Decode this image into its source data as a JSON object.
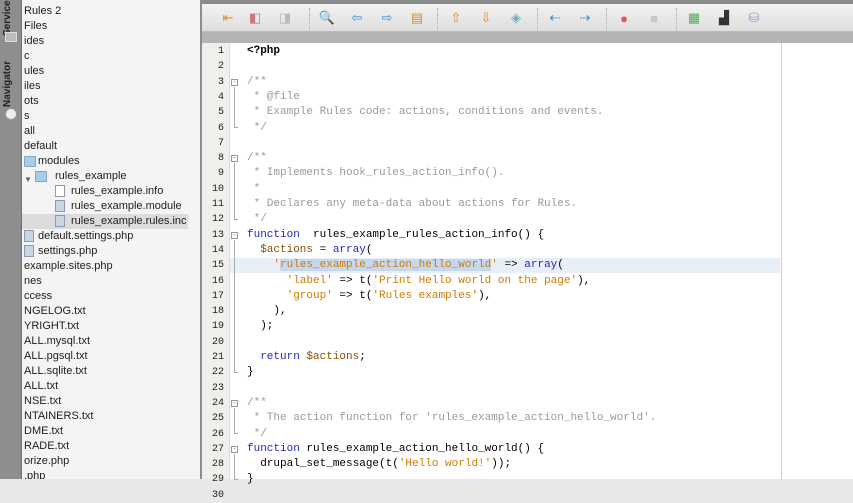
{
  "side_tabs": [
    {
      "label": "Services",
      "icon": "services-icon"
    },
    {
      "label": "Navigator",
      "icon": "compass-icon"
    }
  ],
  "tree": [
    {
      "label": "Rules 2",
      "level": 0,
      "icon": "none"
    },
    {
      "label": "Files",
      "level": 0,
      "icon": "none"
    },
    {
      "label": "ides",
      "level": 0,
      "icon": "none"
    },
    {
      "label": "c",
      "level": 0,
      "icon": "none"
    },
    {
      "label": "ules",
      "level": 0,
      "icon": "none"
    },
    {
      "label": "iles",
      "level": 0,
      "icon": "none"
    },
    {
      "label": "ots",
      "level": 0,
      "icon": "none"
    },
    {
      "label": "s",
      "level": 0,
      "icon": "none"
    },
    {
      "label": "all",
      "level": 0,
      "icon": "none"
    },
    {
      "label": "default",
      "level": 0,
      "icon": "none"
    },
    {
      "label": "modules",
      "level": 1,
      "icon": "folder"
    },
    {
      "label": "rules_example",
      "level": 2,
      "icon": "folder",
      "expanded": true
    },
    {
      "label": "rules_example.info",
      "level": 3,
      "icon": "file"
    },
    {
      "label": "rules_example.module",
      "level": 3,
      "icon": "php"
    },
    {
      "label": "rules_example.rules.inc",
      "level": 3,
      "icon": "php",
      "selected": true
    },
    {
      "label": "default.settings.php",
      "level": 1,
      "icon": "php"
    },
    {
      "label": "settings.php",
      "level": 1,
      "icon": "php"
    },
    {
      "label": "example.sites.php",
      "level": 0,
      "icon": "none"
    },
    {
      "label": "nes",
      "level": 0,
      "icon": "none"
    },
    {
      "label": "ccess",
      "level": 0,
      "icon": "none"
    },
    {
      "label": "NGELOG.txt",
      "level": 0,
      "icon": "none"
    },
    {
      "label": "YRIGHT.txt",
      "level": 0,
      "icon": "none"
    },
    {
      "label": "ALL.mysql.txt",
      "level": 0,
      "icon": "none"
    },
    {
      "label": "ALL.pgsql.txt",
      "level": 0,
      "icon": "none"
    },
    {
      "label": "ALL.sqlite.txt",
      "level": 0,
      "icon": "none"
    },
    {
      "label": "ALL.txt",
      "level": 0,
      "icon": "none"
    },
    {
      "label": "NSE.txt",
      "level": 0,
      "icon": "none"
    },
    {
      "label": "NTAINERS.txt",
      "level": 0,
      "icon": "none"
    },
    {
      "label": "DME.txt",
      "level": 0,
      "icon": "none"
    },
    {
      "label": "RADE.txt",
      "level": 0,
      "icon": "none"
    },
    {
      "label": "orize.php",
      "level": 0,
      "icon": "none"
    },
    {
      ".label": "",
      ".x": "",
      "label": ".php",
      "level": 0,
      "icon": "none"
    }
  ],
  "toolbar": [
    {
      "name": "last-edit-icon",
      "glyph": "⇤",
      "color": "#d98a2b"
    },
    {
      "name": "back-icon",
      "glyph": "◧",
      "color": "#c77"
    },
    {
      "name": "forward-icon",
      "glyph": "◨",
      "color": "#bbb"
    },
    {
      "name": "find-icon",
      "glyph": "🔍",
      "color": "#555"
    },
    {
      "name": "find-previous-icon",
      "glyph": "⇦",
      "color": "#3a8fd0"
    },
    {
      "name": "find-next-icon",
      "glyph": "⇨",
      "color": "#3a8fd0"
    },
    {
      "name": "toggle-highlight-icon",
      "glyph": "▤",
      "color": "#d98a2b"
    },
    {
      "name": "previous-bookmark-icon",
      "glyph": "⇧",
      "color": "#e08a2b"
    },
    {
      "name": "next-bookmark-icon",
      "glyph": "⇩",
      "color": "#e08a2b"
    },
    {
      "name": "toggle-bookmark-icon",
      "glyph": "◈",
      "color": "#7ab"
    },
    {
      "name": "shift-left-icon",
      "glyph": "⇠",
      "color": "#3a8fd0"
    },
    {
      "name": "shift-right-icon",
      "glyph": "⇢",
      "color": "#3a8fd0"
    },
    {
      "name": "start-macro-icon",
      "glyph": "●",
      "color": "#e8505a"
    },
    {
      "name": "stop-macro-icon",
      "glyph": "■",
      "color": "#c8c8c8"
    },
    {
      "name": "comment-icon",
      "glyph": "▦",
      "color": "#4caf50"
    },
    {
      "name": "uncomment-icon",
      "glyph": "▟",
      "color": "#333"
    },
    {
      "name": "database-icon",
      "glyph": "⛁",
      "color": "#9999cc"
    }
  ],
  "code": [
    [
      [
        "b",
        "<?php"
      ]
    ],
    [],
    [
      [
        "c",
        "/**"
      ]
    ],
    [
      [
        "c",
        " * @file"
      ]
    ],
    [
      [
        "c",
        " * Example Rules code: actions, conditions and events."
      ]
    ],
    [
      [
        "c",
        " */"
      ]
    ],
    [],
    [
      [
        "c",
        "/**"
      ]
    ],
    [
      [
        "c",
        " * Implements hook_rules_action_info()."
      ]
    ],
    [
      [
        "c",
        " *"
      ]
    ],
    [
      [
        "c",
        " * Declares any meta-data about actions for Rules."
      ]
    ],
    [
      [
        "c",
        " */"
      ]
    ],
    [
      [
        "k",
        "function"
      ],
      [
        "",
        "  rules_example_rules_action_info() {"
      ]
    ],
    [
      [
        "",
        "  "
      ],
      [
        "v",
        "$actions"
      ],
      [
        "",
        " = "
      ],
      [
        "k",
        "array"
      ],
      [
        "",
        "("
      ]
    ],
    [
      [
        "",
        "    "
      ],
      [
        "s",
        "'"
      ],
      [
        "s sl",
        "rules_example_action_hello_world"
      ],
      [
        "s",
        "'"
      ],
      [
        "",
        " => "
      ],
      [
        "k",
        "array"
      ],
      [
        "",
        "("
      ]
    ],
    [
      [
        "",
        "      "
      ],
      [
        "s",
        "'label'"
      ],
      [
        "",
        " => t("
      ],
      [
        "s",
        "'Print Hello world on the page'"
      ],
      [
        "",
        "),"
      ]
    ],
    [
      [
        "",
        "      "
      ],
      [
        "s",
        "'group'"
      ],
      [
        "",
        " => t("
      ],
      [
        "s",
        "'Rules examples'"
      ],
      [
        "",
        "),"
      ]
    ],
    [
      [
        "",
        "    ),"
      ]
    ],
    [
      [
        "",
        "  );"
      ]
    ],
    [],
    [
      [
        "",
        "  "
      ],
      [
        "k",
        "return"
      ],
      [
        "",
        " "
      ],
      [
        "v",
        "$actions"
      ],
      [
        "",
        ";"
      ]
    ],
    [
      [
        "",
        "}"
      ]
    ],
    [],
    [
      [
        "c",
        "/**"
      ]
    ],
    [
      [
        "c",
        " * The action function for 'rules_example_action_hello_world'."
      ]
    ],
    [
      [
        "c",
        " */"
      ]
    ],
    [
      [
        "k",
        "function"
      ],
      [
        "",
        " rules_example_action_hello_world() {"
      ]
    ],
    [
      [
        "",
        "  drupal_set_message(t("
      ],
      [
        "s",
        "'Hello world!'"
      ],
      [
        "",
        "));"
      ]
    ],
    [
      [
        "",
        "}"
      ]
    ],
    []
  ],
  "fold_lines": {
    "3": "open",
    "6": "end",
    "8": "open",
    "12": "end",
    "13": "open",
    "22": "end",
    "24": "open",
    "26": "end",
    "27": "open",
    "29": "end"
  },
  "highlighted_line": 15
}
